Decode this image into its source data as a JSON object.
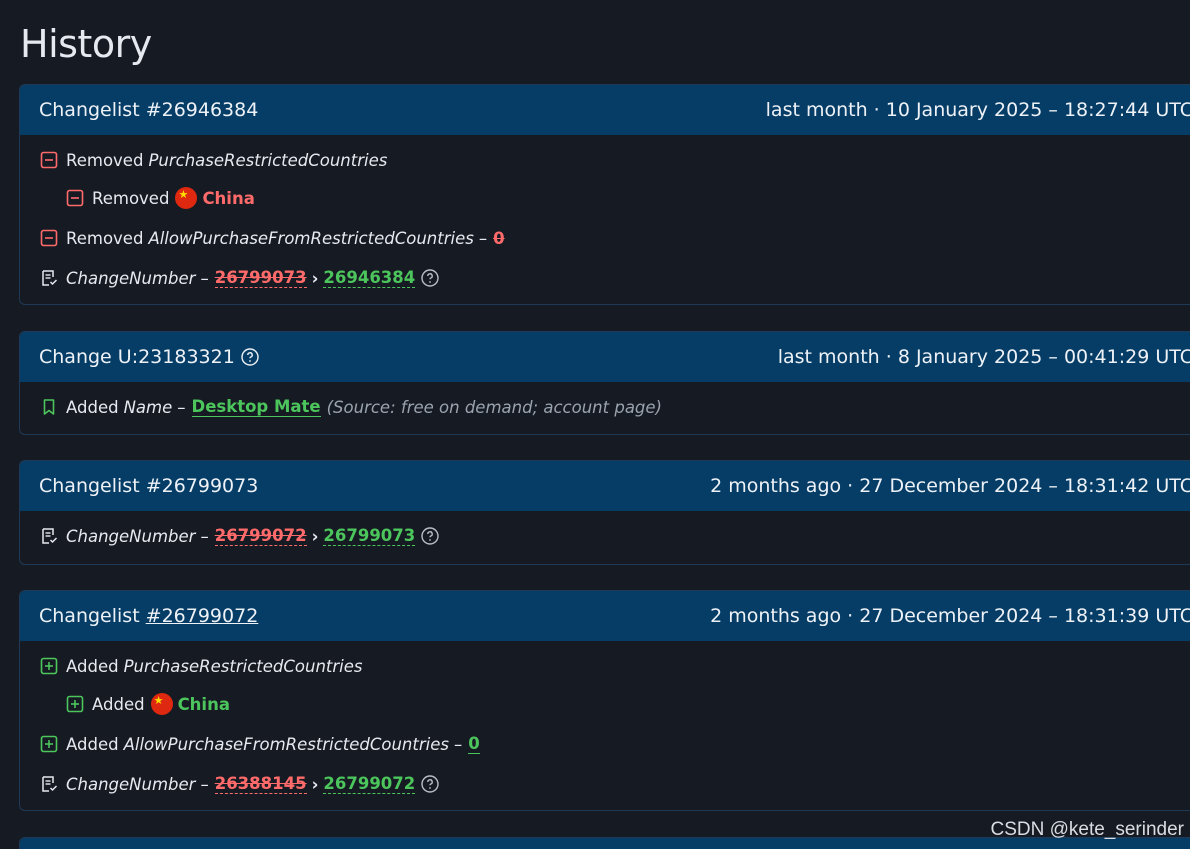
{
  "page_title": "History",
  "cards": [
    {
      "title": "Changelist #26946384",
      "time": "last month · 10 January 2025 – 18:27:44 UTC",
      "r1_action": "Removed",
      "r1_key": "PurchaseRestrictedCountries",
      "r2_action": "Removed",
      "r2_country": "China",
      "r3_action": "Removed",
      "r3_key": "AllowPurchaseFromRestrictedCountries",
      "r3_dash": "–",
      "r3_value": "0",
      "r4_key": "ChangeNumber",
      "r4_dash": "–",
      "r4_old": "26799073",
      "r4_sep": "›",
      "r4_new": "26946384"
    },
    {
      "title": "Change U:23183321",
      "time": "last month · 8 January 2025 – 00:41:29 UTC",
      "r1_action": "Added",
      "r1_key": "Name",
      "r1_dash": "–",
      "r1_value": "Desktop Mate",
      "r1_source": "(Source: free on demand; account page)"
    },
    {
      "title": "Changelist #26799073",
      "time": "2 months ago · 27 December 2024 – 18:31:42 UTC",
      "r1_key": "ChangeNumber",
      "r1_dash": "–",
      "r1_old": "26799072",
      "r1_sep": "›",
      "r1_new": "26799073"
    },
    {
      "title_prefix": "Changelist",
      "title_link": "#26799072",
      "time": "2 months ago · 27 December 2024 – 18:31:39 UTC",
      "r1_action": "Added",
      "r1_key": "PurchaseRestrictedCountries",
      "r2_action": "Added",
      "r2_country": "China",
      "r3_action": "Added",
      "r3_key": "AllowPurchaseFromRestrictedCountries",
      "r3_dash": "–",
      "r3_value": "0",
      "r4_key": "ChangeNumber",
      "r4_dash": "–",
      "r4_old": "26388145",
      "r4_sep": "›",
      "r4_new": "26799072"
    }
  ],
  "watermark": "CSDN @kete_serinder",
  "colors": {
    "header_bg": "#063d66",
    "page_bg": "#161a22",
    "removed": "#ff6b6b",
    "added": "#4cc55c"
  },
  "icons": [
    "minus-square-icon",
    "plus-square-icon",
    "changelist-doc-icon",
    "help-circle-icon",
    "bookmark-icon",
    "china-flag-icon"
  ]
}
